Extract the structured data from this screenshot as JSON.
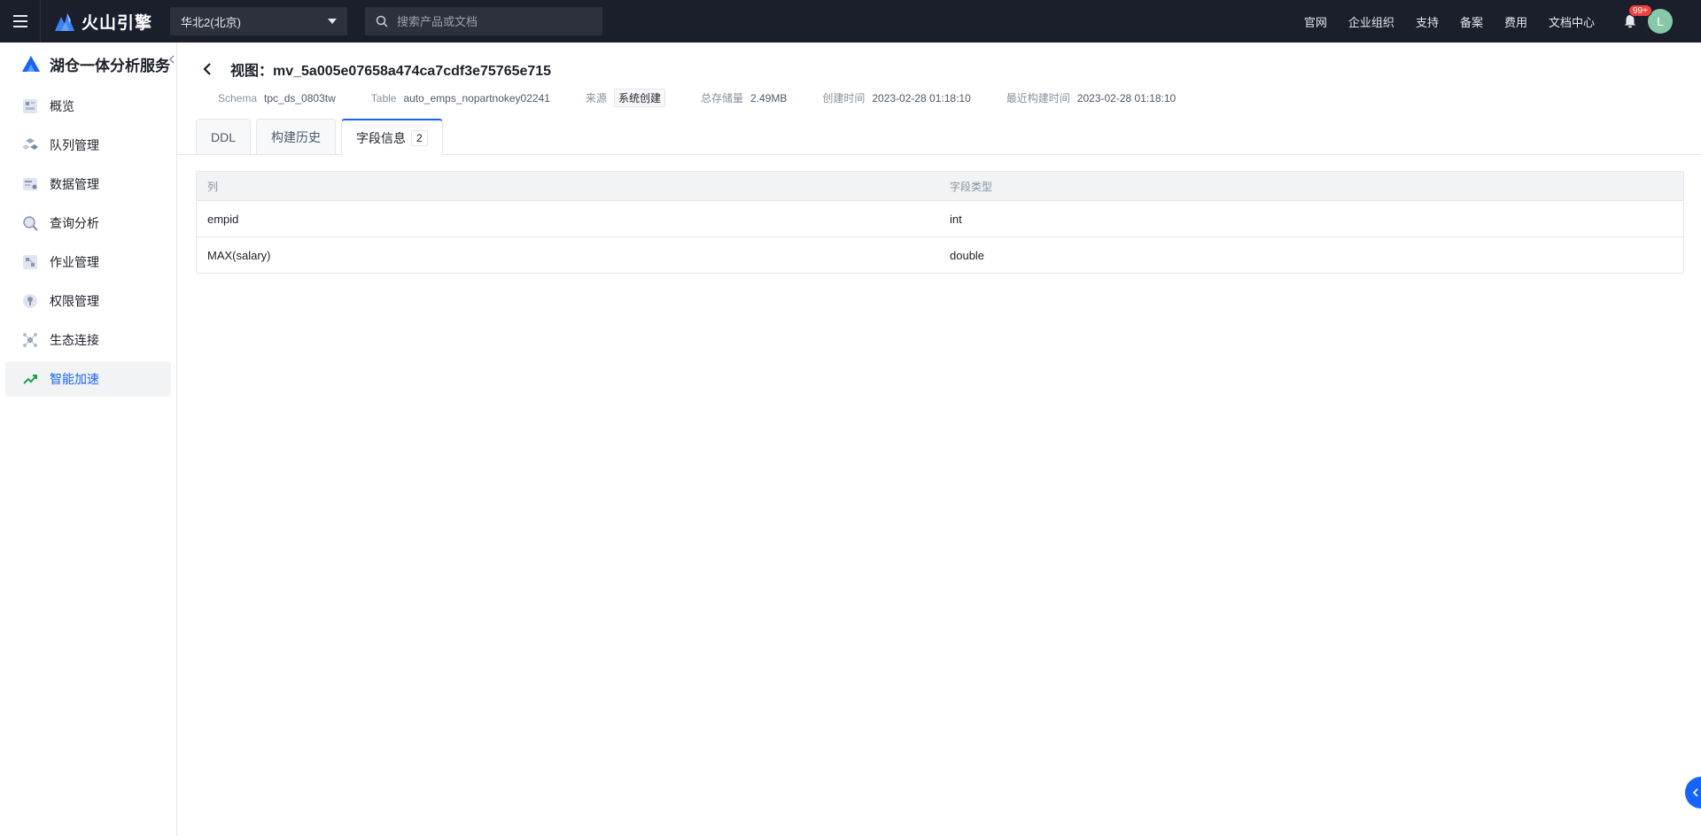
{
  "topbar": {
    "brand": "火山引擎",
    "region": "华北2(北京)",
    "search_placeholder": "搜索产品或文档",
    "links": [
      "官网",
      "企业组织",
      "支持",
      "备案",
      "费用",
      "文档中心"
    ],
    "notification_badge": "99+",
    "avatar_initial": "L"
  },
  "sidebar": {
    "title": "湖仓一体分析服务",
    "items": [
      {
        "label": "概览",
        "icon": "overview-icon"
      },
      {
        "label": "队列管理",
        "icon": "queue-icon"
      },
      {
        "label": "数据管理",
        "icon": "data-icon"
      },
      {
        "label": "查询分析",
        "icon": "query-icon"
      },
      {
        "label": "作业管理",
        "icon": "job-icon"
      },
      {
        "label": "权限管理",
        "icon": "permission-icon"
      },
      {
        "label": "生态连接",
        "icon": "ecosystem-icon"
      },
      {
        "label": "智能加速",
        "icon": "acceleration-icon",
        "active": true
      }
    ]
  },
  "header": {
    "title": "视图：mv_5a005e07658a474ca7cdf3e75765e715",
    "meta": {
      "schema_label": "Schema",
      "schema_value": "tpc_ds_0803tw",
      "table_label": "Table",
      "table_value": "auto_emps_nopartnokey02241",
      "source_label": "来源",
      "source_value": "系统创建",
      "storage_label": "总存储量",
      "storage_value": "2.49MB",
      "created_label": "创建时间",
      "created_value": "2023-02-28 01:18:10",
      "rebuilt_label": "最近构建时间",
      "rebuilt_value": "2023-02-28 01:18:10"
    }
  },
  "tabs": [
    {
      "label": "DDL"
    },
    {
      "label": "构建历史"
    },
    {
      "label": "字段信息",
      "count": "2",
      "active": true
    }
  ],
  "table": {
    "headers": [
      "列",
      "字段类型"
    ],
    "rows": [
      [
        "empid",
        "int"
      ],
      [
        "MAX(salary)",
        "double"
      ]
    ]
  },
  "colors": {
    "accent": "#1664ff",
    "topbar": "#1b1f2b",
    "badge": "#f53f3f"
  }
}
